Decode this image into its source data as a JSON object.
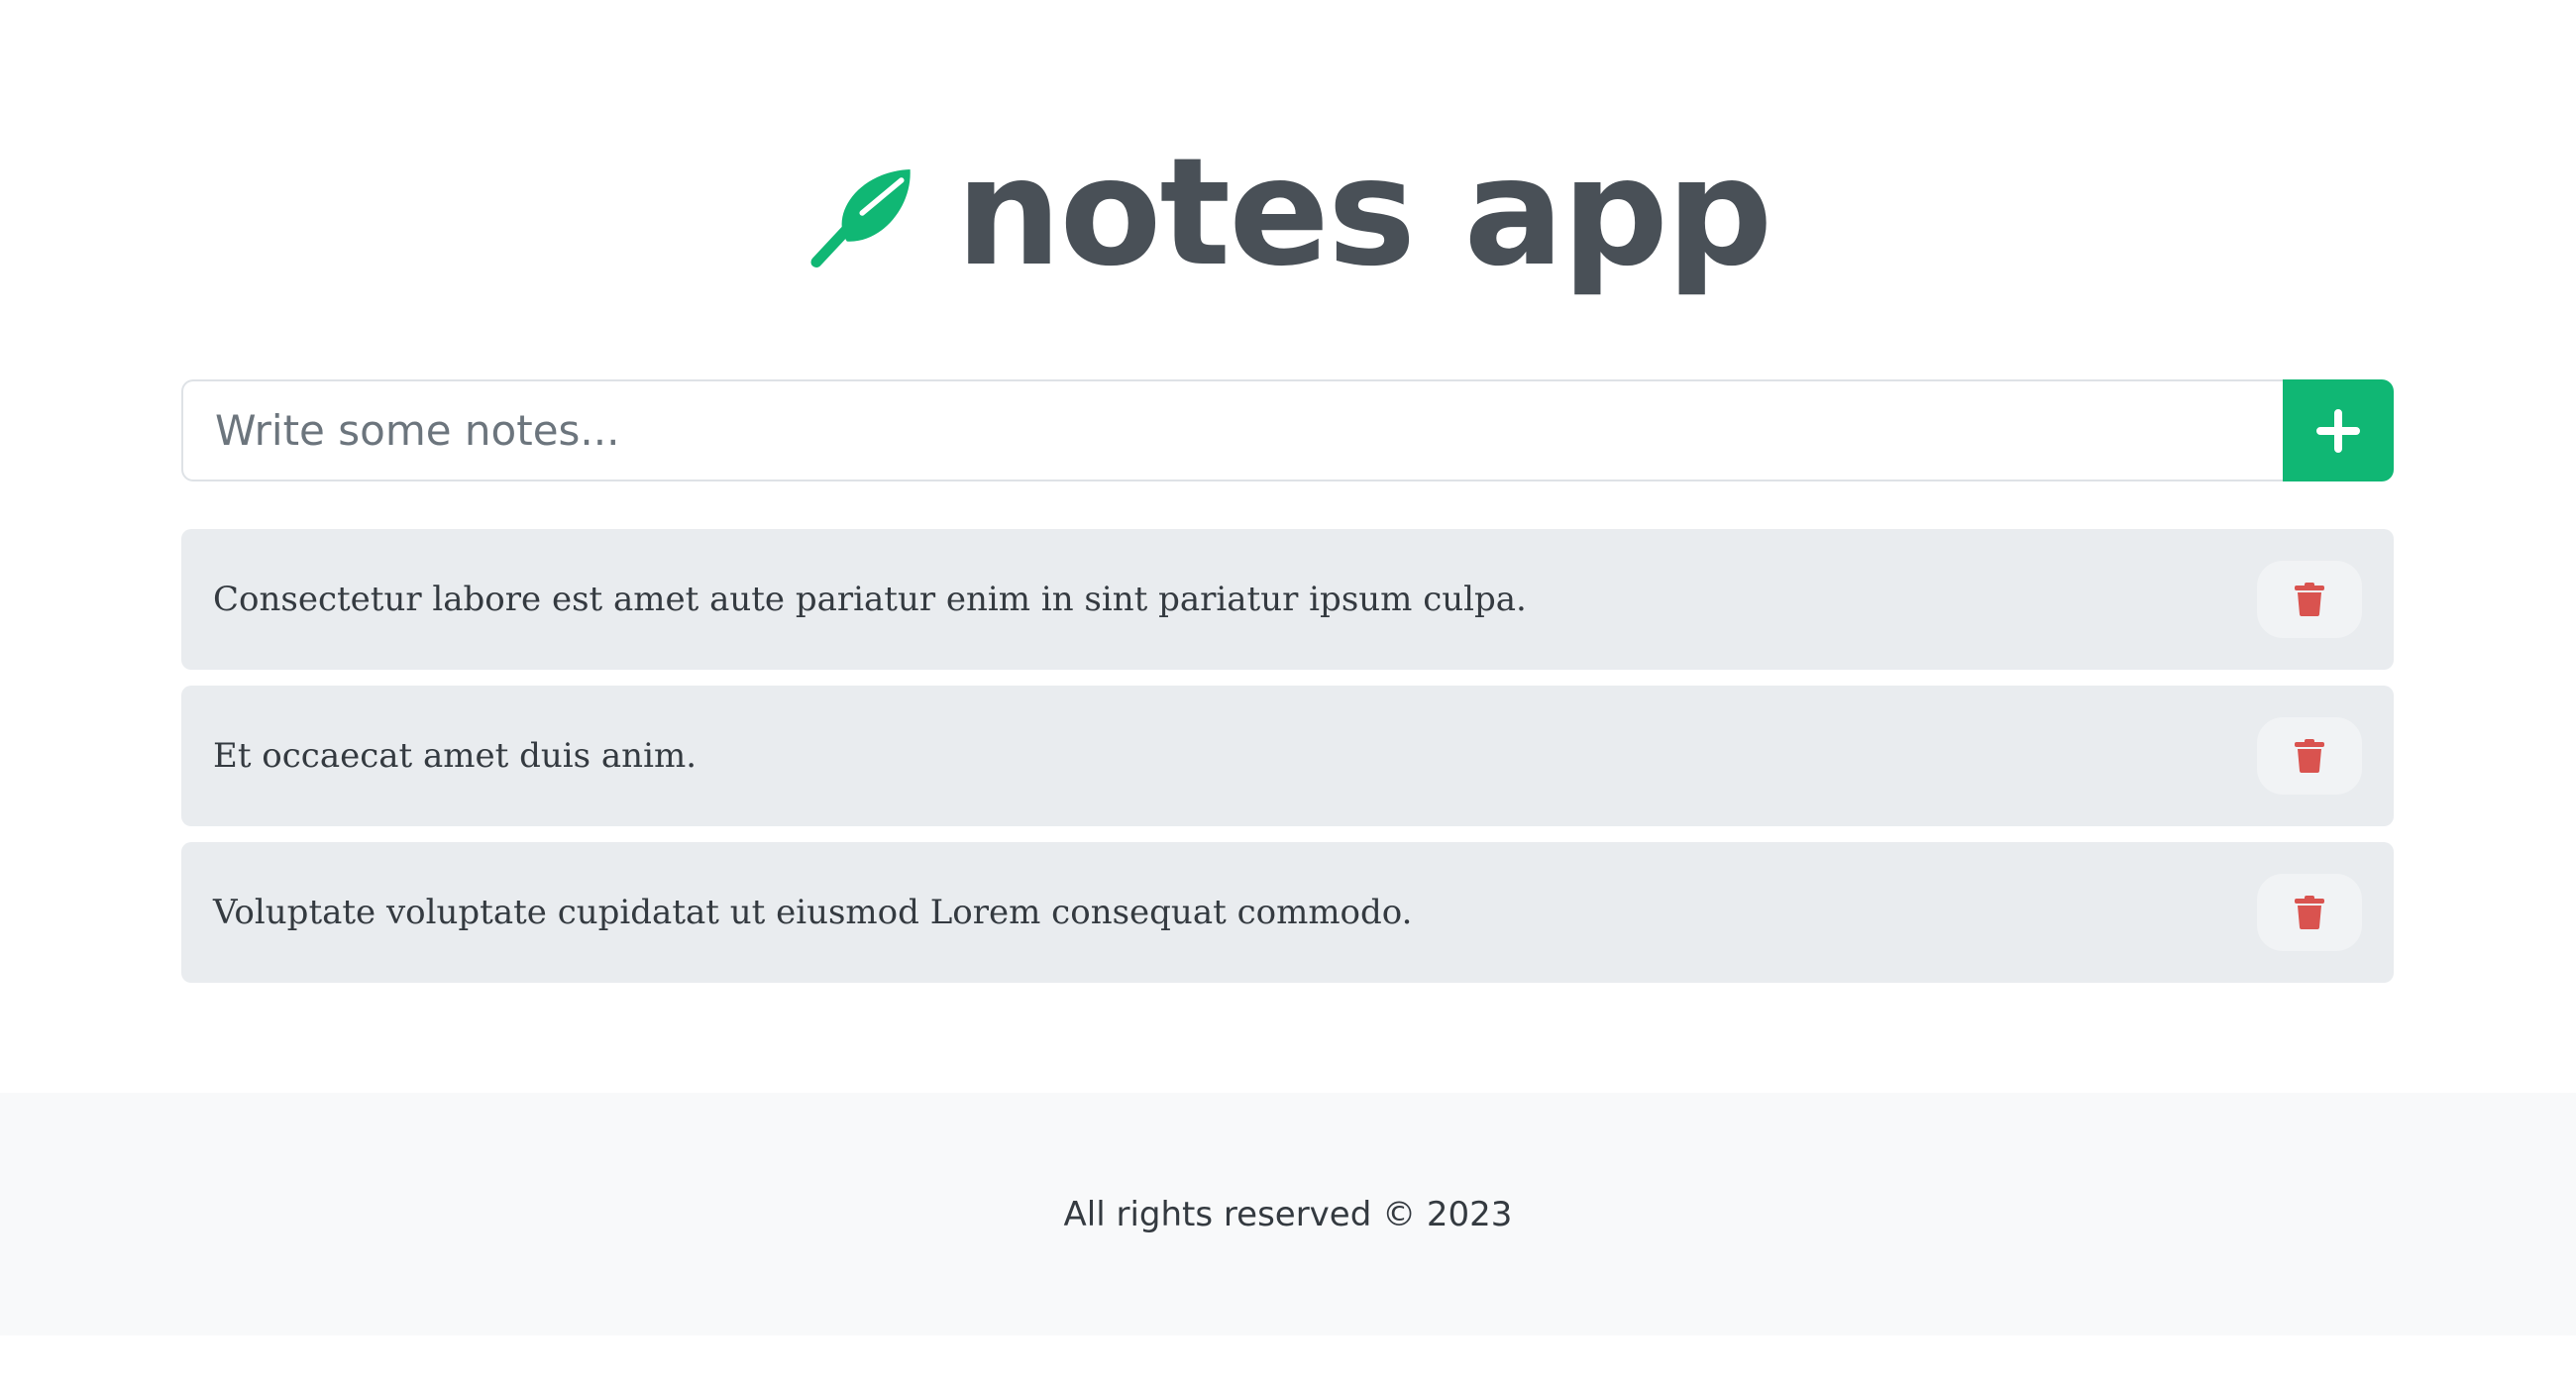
{
  "app": {
    "title": "notes app",
    "logo_icon": "feather-icon",
    "accent_color": "#10b774"
  },
  "form": {
    "placeholder": "Write some notes...",
    "input_value": "",
    "add_button_icon": "plus-icon"
  },
  "notes": [
    {
      "text": "Consectetur labore est amet aute pariatur enim in sint pariatur ipsum culpa.",
      "delete_icon": "trash-icon"
    },
    {
      "text": "Et occaecat amet duis anim.",
      "delete_icon": "trash-icon"
    },
    {
      "text": "Voluptate voluptate cupidatat ut eiusmod Lorem consequat commodo.",
      "delete_icon": "trash-icon"
    }
  ],
  "colors": {
    "delete_icon": "#d9534f",
    "note_background": "#e9ecef",
    "footer_background": "#f8f9fa"
  },
  "footer": {
    "text": "All rights reserved © 2023"
  }
}
